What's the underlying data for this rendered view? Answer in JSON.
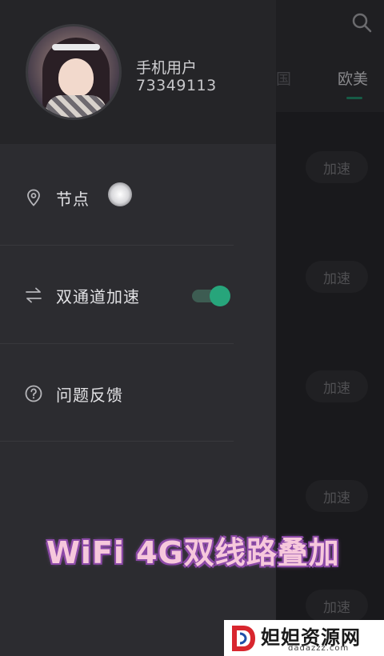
{
  "background": {
    "tabs": {
      "korea": "韩国",
      "euro": "欧美"
    },
    "accelerate_label": "加速"
  },
  "drawer": {
    "user": {
      "name": "手机用户",
      "id": "73349113"
    },
    "items": [
      {
        "label": "节点",
        "icon": "location-pin-icon"
      },
      {
        "label": "双通道加速",
        "icon": "swap-arrows-icon",
        "toggle_on": true
      },
      {
        "label": "问题反馈",
        "icon": "question-circle-icon"
      }
    ]
  },
  "caption": "WiFi 4G双线路叠加",
  "watermark": {
    "title": "妲妲资源网",
    "url": "dadazzz.com"
  },
  "colors": {
    "accent": "#27a57b",
    "caption": "#f6c8dc"
  }
}
